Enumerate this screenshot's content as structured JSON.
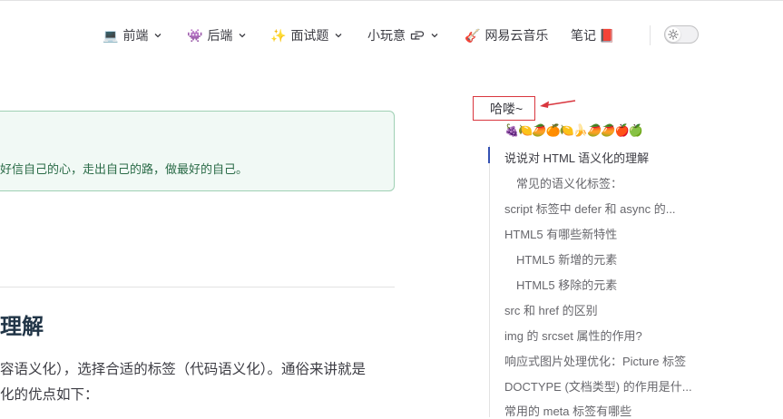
{
  "nav": {
    "items": [
      {
        "emoji": "💻",
        "label": "前端",
        "has_dropdown": true
      },
      {
        "emoji": "👾",
        "label": "后端",
        "has_dropdown": true
      },
      {
        "emoji": "✨",
        "label": "面试题",
        "has_dropdown": true
      },
      {
        "emoji": "",
        "label": "小玩意",
        "has_dropdown": true,
        "trailing_icon": "hand-pointing-icon"
      },
      {
        "emoji": "🎸",
        "label": "网易云音乐",
        "has_dropdown": false
      },
      {
        "emoji": "",
        "label": "笔记",
        "has_dropdown": false,
        "trailing_emoji": "📕"
      }
    ],
    "theme_toggle_icon": "sun-icon"
  },
  "main": {
    "tip_text": "好信自己的心，走出自己的路，做最好的自己。",
    "heading": "理解",
    "paragraph_lines": [
      "容语义化），选择合适的标签（代码语义化）。通俗来讲就是",
      "化的优点如下："
    ]
  },
  "aside": {
    "hello": "哈喽~",
    "fruits": "🍇🍋🥭🍊🍋🍌🥭🥭🍎🍏",
    "toc": [
      {
        "label": "说说对 HTML 语义化的理解",
        "level": 1,
        "active": true
      },
      {
        "label": "常见的语义化标签：",
        "level": 2,
        "active": false
      },
      {
        "label": "script 标签中 defer 和 async 的...",
        "level": 1,
        "active": false
      },
      {
        "label": "HTML5 有哪些新特性",
        "level": 1,
        "active": false
      },
      {
        "label": "HTML5 新增的元素",
        "level": 2,
        "active": false
      },
      {
        "label": "HTML5 移除的元素",
        "level": 2,
        "active": false
      },
      {
        "label": "src 和 href 的区别",
        "level": 1,
        "active": false
      },
      {
        "label": "img 的 srcset 属性的作用?",
        "level": 1,
        "active": false
      },
      {
        "label": "响应式图片处理优化：Picture 标签",
        "level": 1,
        "active": false
      },
      {
        "label": "DOCTYPE (文档类型) 的作用是什...",
        "level": 1,
        "active": false
      },
      {
        "label": "常用的 meta 标签有哪些",
        "level": 1,
        "active": false
      }
    ]
  },
  "colors": {
    "accent": "#3451b2",
    "tip_border": "#9fd0b4",
    "tip_bg": "#f1f9f5",
    "annotation_red": "#d9363e"
  }
}
